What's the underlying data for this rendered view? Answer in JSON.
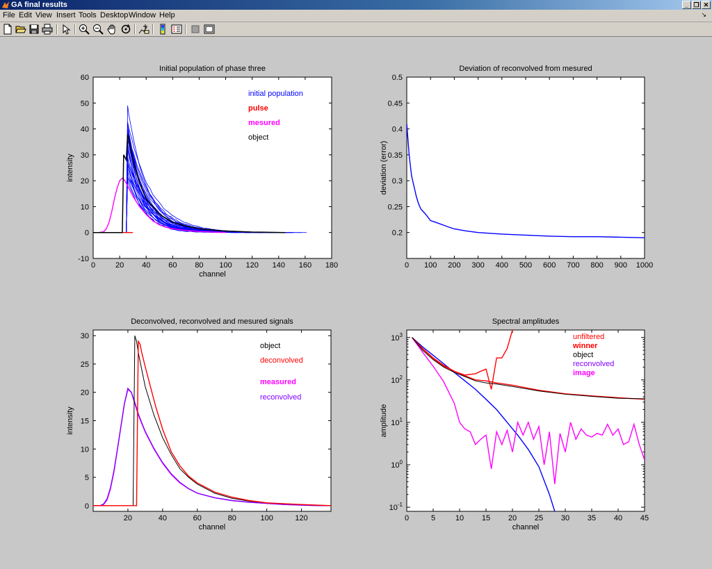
{
  "window": {
    "title": "GA final results"
  },
  "menu": [
    "File",
    "Edit",
    "View",
    "Insert",
    "Tools",
    "Desktop",
    "Window",
    "Help"
  ],
  "toolbar": [
    "new-figure-icon",
    "open-icon",
    "save-icon",
    "print-icon",
    "select-arrow-icon",
    "zoom-in-icon",
    "zoom-out-icon",
    "pan-hand-icon",
    "rotate-icon",
    "data-cursor-icon",
    "colorbar-icon",
    "legend-icon",
    "hide-plot-tools-icon",
    "show-plot-tools-icon"
  ],
  "colors": {
    "blue": "#0000ff",
    "red": "#ff0000",
    "magenta": "#ff00ff",
    "black": "#000000",
    "purple": "#8000ff"
  },
  "chart_data": [
    {
      "type": "line",
      "title": "Initial population of phase three",
      "xlabel": "channel",
      "ylabel": "intensity",
      "xlim": [
        0,
        180
      ],
      "ylim": [
        -10,
        60
      ],
      "xticks": [
        0,
        20,
        40,
        60,
        80,
        100,
        120,
        140,
        160,
        180
      ],
      "yticks": [
        -10,
        0,
        10,
        20,
        30,
        40,
        50,
        60
      ],
      "legend": [
        {
          "text": "initial population",
          "color": "#0000ff",
          "bold": false
        },
        {
          "text": "pulse",
          "color": "#ff0000",
          "bold": true
        },
        {
          "text": "mesured",
          "color": "#ff00ff",
          "bold": true
        },
        {
          "text": "object",
          "color": "#000000",
          "bold": false
        }
      ],
      "population": {
        "color": "#0000ff",
        "count": 26,
        "start_x": 26,
        "peak_min": 20,
        "peak_max": 52,
        "end_x_range": [
          110,
          162
        ]
      },
      "series": [
        {
          "name": "pulse",
          "color": "#ff0000",
          "x": [
            0,
            5,
            10,
            15,
            20,
            22,
            25,
            27,
            30
          ],
          "y": [
            0,
            0,
            0,
            0,
            0,
            0,
            0,
            0,
            0
          ]
        },
        {
          "name": "mesured",
          "color": "#ff00ff",
          "x": [
            0,
            4,
            8,
            10,
            12,
            14,
            16,
            18,
            20,
            22,
            24,
            26,
            28,
            30,
            35,
            40,
            45,
            50,
            55,
            60,
            70,
            80,
            90,
            100
          ],
          "y": [
            0,
            0,
            0.3,
            1.5,
            4,
            8,
            13,
            17,
            20,
            21,
            20,
            18,
            16,
            14,
            10,
            7,
            4.5,
            3,
            2,
            1.5,
            0.8,
            0.4,
            0.2,
            0
          ]
        },
        {
          "name": "object",
          "color": "#000000",
          "x": [
            0,
            20,
            22,
            23,
            24,
            25,
            26,
            27,
            28,
            30,
            35,
            40,
            50,
            60,
            70,
            80,
            90,
            100,
            120,
            145
          ],
          "y": [
            0,
            0,
            0,
            30,
            29,
            28,
            38,
            36,
            33,
            28,
            19,
            13,
            7,
            4,
            2.5,
            1.5,
            1,
            0.6,
            0.2,
            0
          ]
        }
      ]
    },
    {
      "type": "line",
      "title": "Deviation of reconvolved from mesured",
      "xlabel": "",
      "ylabel": "deviation (error)",
      "xlim": [
        0,
        1000
      ],
      "ylim": [
        0.15,
        0.5
      ],
      "xticks": [
        0,
        100,
        200,
        300,
        400,
        500,
        600,
        700,
        800,
        900,
        1000
      ],
      "yticks": [
        0.2,
        0.25,
        0.3,
        0.35,
        0.4,
        0.45,
        0.5
      ],
      "series": [
        {
          "name": "",
          "color": "#0000ff",
          "x": [
            0,
            5,
            10,
            15,
            20,
            30,
            40,
            50,
            60,
            70,
            80,
            100,
            120,
            150,
            180,
            200,
            250,
            300,
            400,
            500,
            600,
            700,
            800,
            900,
            1000
          ],
          "y": [
            0.41,
            0.38,
            0.35,
            0.33,
            0.31,
            0.29,
            0.27,
            0.255,
            0.245,
            0.24,
            0.235,
            0.223,
            0.22,
            0.215,
            0.21,
            0.207,
            0.203,
            0.2,
            0.197,
            0.195,
            0.193,
            0.192,
            0.192,
            0.191,
            0.19
          ]
        }
      ]
    },
    {
      "type": "line",
      "title": "Deconvolved, reconvolved and mesured signals",
      "xlabel": "channel",
      "ylabel": "intensity",
      "xlim": [
        0,
        137
      ],
      "ylim": [
        -1,
        31
      ],
      "xticks": [
        20,
        40,
        60,
        80,
        100,
        120
      ],
      "yticks": [
        0,
        5,
        10,
        15,
        20,
        25,
        30
      ],
      "legend": [
        {
          "text": "object",
          "color": "#000000",
          "bold": false
        },
        {
          "text": "deconvolved",
          "color": "#ff0000",
          "bold": false
        },
        {
          "text": "measured",
          "color": "#ff00ff",
          "bold": true
        },
        {
          "text": "reconvolved",
          "color": "#8000ff",
          "bold": false
        }
      ],
      "series": [
        {
          "name": "measured",
          "color": "#ff00ff",
          "x": [
            0,
            2,
            4,
            6,
            8,
            10,
            12,
            14,
            16,
            18,
            20,
            22,
            24,
            26,
            28,
            30,
            35,
            40,
            45,
            50,
            55,
            60,
            70,
            80,
            90,
            100,
            110,
            120,
            130,
            137
          ],
          "y": [
            0,
            0,
            0,
            0.2,
            1,
            3,
            6,
            10,
            14,
            18,
            20.5,
            20,
            18,
            16,
            14.5,
            13,
            10,
            7.5,
            5.5,
            4,
            3,
            2.2,
            1.4,
            0.9,
            0.6,
            0.4,
            0.2,
            0.1,
            0,
            0
          ]
        },
        {
          "name": "reconvolved",
          "color": "#8000ff",
          "x": [
            0,
            2,
            4,
            6,
            8,
            10,
            12,
            14,
            16,
            18,
            20,
            22,
            24,
            26,
            28,
            30,
            35,
            40,
            45,
            50,
            55,
            60,
            70,
            80,
            90,
            100,
            110,
            120,
            130,
            137
          ],
          "y": [
            0,
            0,
            0,
            0.3,
            1.2,
            3.2,
            6.2,
            10,
            14,
            18,
            20.7,
            20,
            18.2,
            16.2,
            14.6,
            13.1,
            10.1,
            7.6,
            5.6,
            4.1,
            3,
            2.2,
            1.4,
            0.9,
            0.6,
            0.4,
            0.2,
            0.1,
            0,
            0
          ]
        },
        {
          "name": "object",
          "color": "#000000",
          "x": [
            0,
            10,
            20,
            23,
            24,
            25,
            26,
            28,
            30,
            35,
            40,
            45,
            50,
            55,
            60,
            70,
            80,
            90,
            100,
            120,
            137
          ],
          "y": [
            0,
            0,
            0,
            0,
            30,
            29,
            27,
            24,
            21,
            16,
            12,
            9,
            6.5,
            5,
            3.8,
            2.2,
            1.3,
            0.8,
            0.5,
            0.2,
            0
          ]
        },
        {
          "name": "deconvolved",
          "color": "#ff0000",
          "x": [
            0,
            10,
            20,
            25,
            26,
            27,
            28,
            30,
            33,
            36,
            40,
            45,
            50,
            55,
            60,
            70,
            80,
            90,
            100,
            120,
            137
          ],
          "y": [
            0,
            0,
            0,
            0,
            29,
            28.5,
            27,
            24.5,
            21,
            17.5,
            13.5,
            9.5,
            7,
            5.2,
            4,
            2.4,
            1.5,
            0.9,
            0.5,
            0.2,
            0
          ]
        }
      ]
    },
    {
      "type": "line",
      "title": "Spectral amplitudes",
      "xlabel": "channel",
      "ylabel": "amplitude",
      "xlim": [
        0,
        45
      ],
      "ylog": true,
      "ylim": [
        0.08,
        1500
      ],
      "xticks": [
        0,
        5,
        10,
        15,
        20,
        25,
        30,
        35,
        40,
        45
      ],
      "yticks_exp": [
        -1,
        0,
        1,
        2,
        3
      ],
      "legend": [
        {
          "text": "unfiltered",
          "color": "#ff0000",
          "bold": false
        },
        {
          "text": "winner",
          "color": "#ff0000",
          "bold": true
        },
        {
          "text": "object",
          "color": "#000000",
          "bold": false
        },
        {
          "text": "reconvolved",
          "color": "#8000ff",
          "bold": false
        },
        {
          "text": "image",
          "color": "#ff00ff",
          "bold": true
        }
      ],
      "series": [
        {
          "name": "reconvolved",
          "color": "#0000ff",
          "x": [
            1,
            3,
            5,
            7,
            9,
            11,
            13,
            15,
            17,
            19,
            21,
            23,
            25,
            27,
            28
          ],
          "y": [
            1000,
            600,
            380,
            240,
            150,
            95,
            60,
            35,
            20,
            10,
            5,
            2.3,
            0.9,
            0.2,
            0.08
          ]
        },
        {
          "name": "image",
          "color": "#ff00ff",
          "x": [
            1,
            3,
            5,
            7,
            8,
            9,
            10,
            11,
            12,
            13,
            14,
            15,
            16,
            17,
            18,
            19,
            20,
            21,
            22,
            23,
            24,
            25,
            26,
            27,
            28,
            29,
            30,
            31,
            32,
            33,
            34,
            35,
            36,
            37,
            38,
            39,
            40,
            41,
            42,
            43,
            44,
            45
          ],
          "y": [
            1000,
            450,
            210,
            90,
            50,
            28,
            10,
            7,
            6,
            3,
            4,
            5,
            0.8,
            6,
            3,
            6.5,
            2,
            10,
            5,
            10,
            4,
            8,
            1,
            6,
            0.35,
            5.5,
            2,
            10,
            4,
            7,
            5,
            4.5,
            5.5,
            5,
            9,
            5,
            7,
            3,
            3.5,
            9,
            3,
            1.3
          ]
        },
        {
          "name": "unfiltered",
          "color": "#ff0000",
          "x": [
            1,
            3,
            5,
            7,
            9,
            11,
            13,
            14,
            15,
            16,
            17,
            18,
            19,
            20
          ],
          "y": [
            1000,
            550,
            330,
            220,
            160,
            130,
            140,
            160,
            180,
            60,
            330,
            330,
            550,
            1500
          ]
        },
        {
          "name": "winner",
          "color": "#ff0000",
          "x": [
            1,
            3,
            5,
            7,
            9,
            11,
            13,
            15,
            17,
            20,
            25,
            30,
            35,
            40,
            45
          ],
          "y": [
            1000,
            540,
            320,
            210,
            160,
            125,
            100,
            95,
            85,
            75,
            57,
            47,
            42,
            38,
            35
          ]
        },
        {
          "name": "object",
          "color": "#000000",
          "x": [
            1,
            3,
            5,
            7,
            9,
            11,
            13,
            15,
            17,
            20,
            25,
            30,
            35,
            40,
            45
          ],
          "y": [
            1000,
            500,
            300,
            200,
            150,
            120,
            95,
            85,
            80,
            70,
            55,
            46,
            41,
            37,
            36
          ]
        }
      ]
    }
  ]
}
